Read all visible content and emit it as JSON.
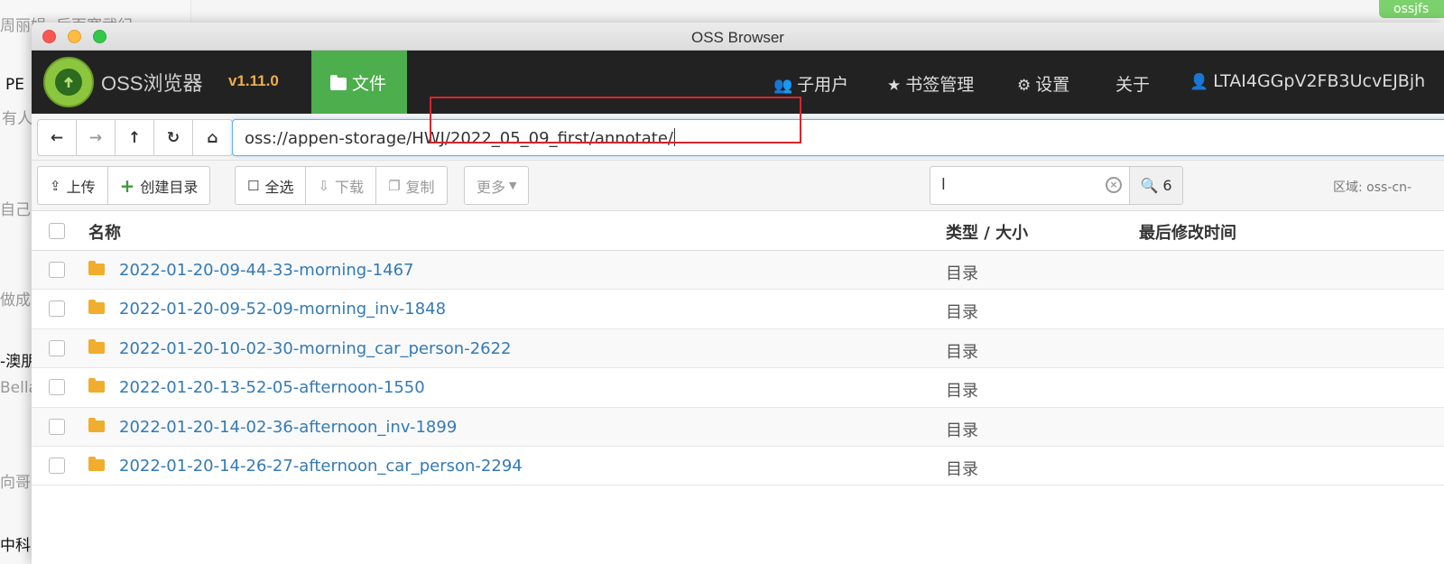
{
  "background": {
    "items": [
      {
        "text": "周丽娟: 后面寒武纪"
      },
      {
        "text": "PE"
      },
      {
        "text": "有人"
      },
      {
        "text": "自己妥"
      },
      {
        "text": "做成"
      },
      {
        "text": "-澳朋"
      },
      {
        "text": "Bella"
      },
      {
        "text": "向哥:"
      },
      {
        "text": "中科"
      }
    ],
    "topright_text": "ossjfs"
  },
  "window": {
    "title": "OSS Browser"
  },
  "navbar": {
    "brand": "OSS浏览器",
    "version": "v1.11.0",
    "files_label": "文件",
    "subusers_label": "子用户",
    "bookmarks_label": "书签管理",
    "settings_label": "设置",
    "about_label": "关于",
    "account_label": "LTAI4GGpV2FB3UcvEJBjh"
  },
  "address": {
    "value": "oss://appen-storage/HWJ/2022_05_09_first/annotate/"
  },
  "toolbar": {
    "upload_label": "上传",
    "mkdir_label": "创建目录",
    "select_all_label": "全选",
    "download_label": "下载",
    "copy_label": "复制",
    "more_label": "更多",
    "search_value": "l",
    "search_count": "6",
    "region_label": "区域: oss-cn-"
  },
  "table": {
    "headers": {
      "name": "名称",
      "type_size": "类型 / 大小",
      "modified": "最后修改时间"
    },
    "rows": [
      {
        "name": "2022-01-20-09-44-33-morning-1467",
        "type": "目录"
      },
      {
        "name": "2022-01-20-09-52-09-morning_inv-1848",
        "type": "目录"
      },
      {
        "name": "2022-01-20-10-02-30-morning_car_person-2622",
        "type": "目录"
      },
      {
        "name": "2022-01-20-13-52-05-afternoon-1550",
        "type": "目录"
      },
      {
        "name": "2022-01-20-14-02-36-afternoon_inv-1899",
        "type": "目录"
      },
      {
        "name": "2022-01-20-14-26-27-afternoon_car_person-2294",
        "type": "目录"
      }
    ]
  }
}
